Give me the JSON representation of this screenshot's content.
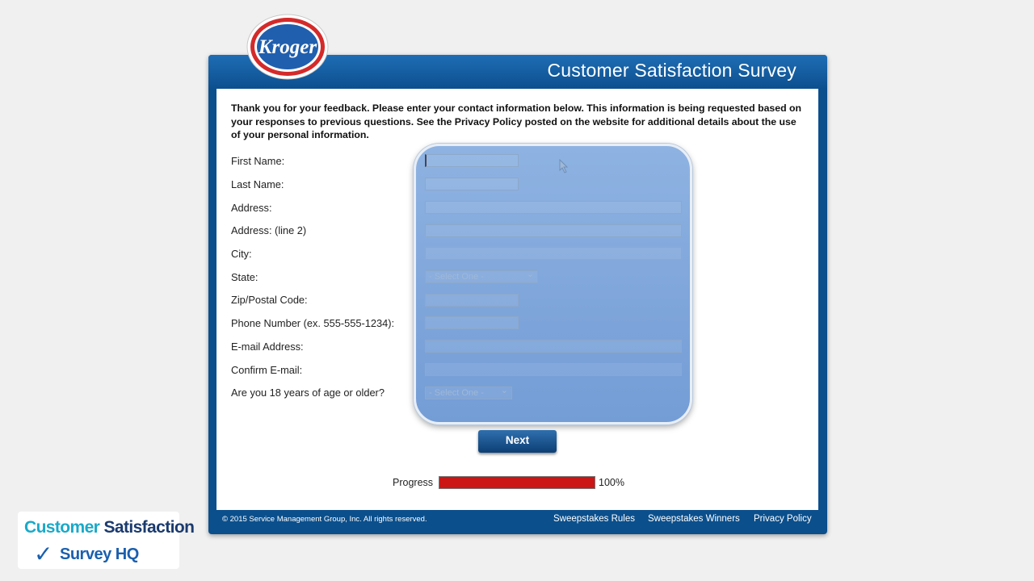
{
  "header": {
    "title": "Customer Satisfaction Survey",
    "logo_text": "Kroger"
  },
  "intro": "Thank you for your feedback. Please enter your contact information below. This information is being requested based on your responses to previous questions. See the Privacy Policy posted on the website for additional details about the use of your personal information.",
  "form": {
    "fields": [
      {
        "label": "First Name:",
        "value": ""
      },
      {
        "label": "Last Name:",
        "value": ""
      },
      {
        "label": "Address:",
        "value": ""
      },
      {
        "label": "Address: (line 2)",
        "value": ""
      },
      {
        "label": "City:",
        "value": ""
      },
      {
        "label": "State:",
        "value": "- Select One -"
      },
      {
        "label": "Zip/Postal Code:",
        "value": ""
      },
      {
        "label": "Phone Number (ex. 555-555-1234):",
        "value": ""
      },
      {
        "label": "E-mail Address:",
        "value": ""
      },
      {
        "label": "Confirm E-mail:",
        "value": ""
      },
      {
        "label": "Are you 18 years of age or older?",
        "value": "- Select One -"
      }
    ]
  },
  "next_label": "Next",
  "progress": {
    "label": "Progress",
    "value_text": "100%",
    "fraction": 1.0
  },
  "footer": {
    "copyright": "© 2015 Service Management Group, Inc. All rights reserved.",
    "links": [
      "Sweepstakes Rules",
      "Sweepstakes Winners",
      "Privacy Policy"
    ]
  },
  "badge": {
    "line1a": "Customer",
    "line1b": "Satisfaction",
    "line2": "Survey HQ"
  },
  "colors": {
    "frame_blue": "#0b4f8c",
    "overlay_blue": "#82a8dc",
    "progress_red": "#cc1515",
    "badge_teal": "#1aa9c8",
    "badge_navy": "#1a3a6e"
  }
}
